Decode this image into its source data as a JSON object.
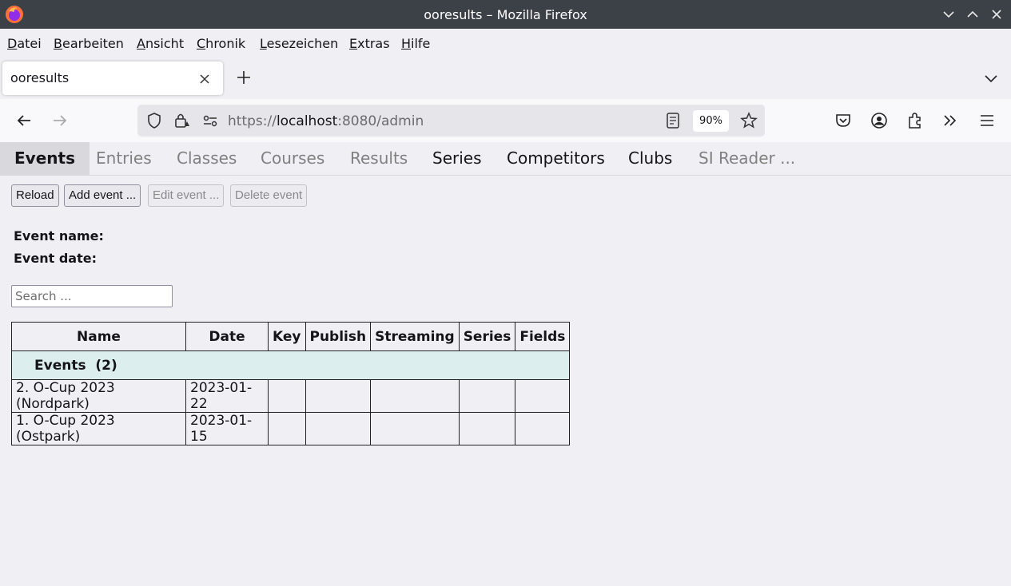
{
  "window": {
    "title": "ooresults – Mozilla Firefox"
  },
  "menu": {
    "items": [
      "Datei",
      "Bearbeiten",
      "Ansicht",
      "Chronik",
      "Lesezeichen",
      "Extras",
      "Hilfe"
    ]
  },
  "browser_tab": {
    "title": "ooresults"
  },
  "url": {
    "scheme": "https://",
    "host": "localhost",
    "rest": ":8080/admin"
  },
  "zoom": "90%",
  "app_tabs": [
    "Events",
    "Entries",
    "Classes",
    "Courses",
    "Results",
    "Series",
    "Competitors",
    "Clubs",
    "SI Reader ..."
  ],
  "buttons": {
    "reload": "Reload",
    "add": "Add event ...",
    "edit": "Edit event ...",
    "delete": "Delete event"
  },
  "event_info": {
    "name_label": "Event name:",
    "date_label": "Event date:"
  },
  "search": {
    "placeholder": "Search ..."
  },
  "table": {
    "columns": [
      "Name",
      "Date",
      "Key",
      "Publish",
      "Streaming",
      "Series",
      "Fields"
    ],
    "group_label": "Events  (2)",
    "rows": [
      {
        "name": "2. O-Cup 2023 (Nordpark)",
        "date": "2023-01-22",
        "key": "",
        "publish": "",
        "streaming": "",
        "series": "",
        "fields": ""
      },
      {
        "name": "1. O-Cup 2023 (Ostpark)",
        "date": "2023-01-15",
        "key": "",
        "publish": "",
        "streaming": "",
        "series": "",
        "fields": ""
      }
    ]
  },
  "icons": [
    "firefox-logo",
    "minimize-icon",
    "maximize-icon",
    "close-icon",
    "tab-close-icon",
    "new-tab-icon",
    "list-tabs-icon",
    "back-icon",
    "forward-icon",
    "shield-icon",
    "lock-icon",
    "permissions-icon",
    "reader-view-icon",
    "bookmark-star-icon",
    "pocket-icon",
    "account-icon",
    "extensions-icon",
    "overflow-icon",
    "hamburger-menu-icon"
  ]
}
